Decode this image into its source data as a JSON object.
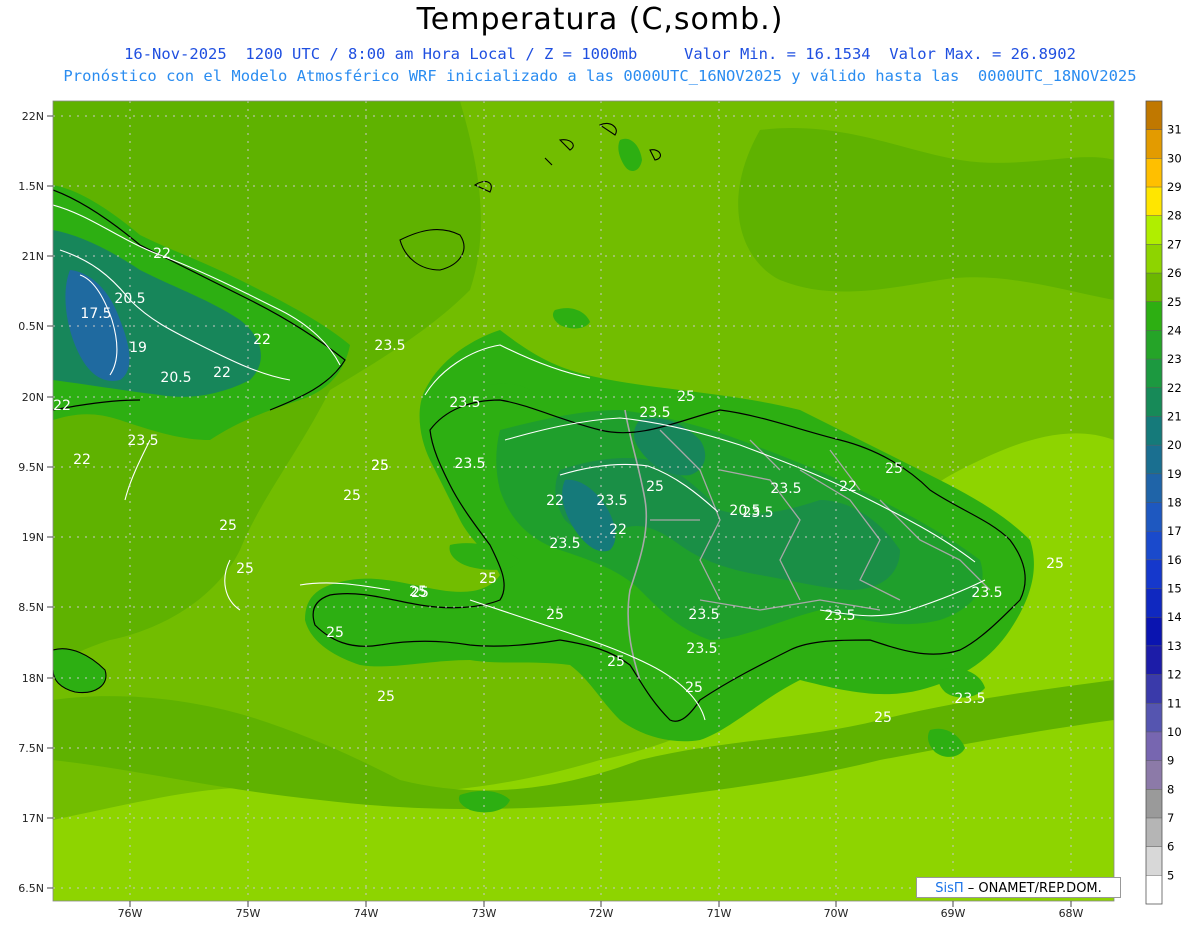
{
  "header": {
    "title": "Temperatura (C,somb.)",
    "line1_left": "16-Nov-2025  1200 UTC / 8:00 am Hora Local / Z = 1000mb",
    "line1_min": "Valor Min. = 16.1534",
    "line1_max": "Valor Max. = 26.8902",
    "line2": "Pronóstico con el Modelo Atmosférico WRF inicializado a las 0000UTC_16NOV2025 y válido hasta las  0000UTC_18NOV2025"
  },
  "map": {
    "lat_labels": [
      "22N",
      "1.5N",
      "21N",
      "0.5N",
      "20N",
      "9.5N",
      "19N",
      "8.5N",
      "18N",
      "7.5N",
      "17N",
      "6.5N"
    ],
    "lon_labels": [
      "76W",
      "75W",
      "74W",
      "73W",
      "72W",
      "71W",
      "70W",
      "69W",
      "68W"
    ],
    "contour_labels": [
      "22",
      "20.5",
      "17.5",
      "19",
      "20.5",
      "22",
      "22",
      "22",
      "23.5",
      "22",
      "23.5",
      "25",
      "25",
      "25",
      "25",
      "23.5",
      "25",
      "25",
      "23.5",
      "25",
      "22",
      "23.5",
      "25",
      "22",
      "23.5",
      "20.5",
      "23.5",
      "23.5",
      "22",
      "23.5",
      "23.5",
      "25",
      "25",
      "25",
      "25",
      "25",
      "23.5",
      "23.5",
      "23.5",
      "25",
      "25",
      "23.5",
      "25",
      "25",
      "25"
    ],
    "colors": {
      "ocean_dark": "#5fb200",
      "ocean_mid": "#72bd00",
      "ocean_light": "#8ed400",
      "land_24": "#2daf12",
      "land_23": "#1f9f2c",
      "land_22": "#1a8f46",
      "land_21": "#17865a",
      "land_20": "#157a7a",
      "land_19": "#1f6aa0"
    }
  },
  "colorbar": {
    "levels": [
      "31",
      "30",
      "29",
      "28",
      "27",
      "26",
      "25",
      "24",
      "23",
      "22",
      "21",
      "20",
      "19",
      "18",
      "17",
      "16",
      "15",
      "14",
      "13",
      "12",
      "11",
      "10",
      "9",
      "8",
      "7",
      "6",
      "5"
    ],
    "colors": [
      "#c07800",
      "#e39b00",
      "#ffbf00",
      "#ffe600",
      "#b0ee00",
      "#8ed400",
      "#6cb800",
      "#2daf12",
      "#25a428",
      "#1c9940",
      "#178a58",
      "#157a7a",
      "#1a6f90",
      "#1f64a8",
      "#1e58c0",
      "#1a4acc",
      "#1538cc",
      "#0f28c0",
      "#0a14b0",
      "#1c1ca8",
      "#3a3aaa",
      "#5555b0",
      "#7766b0",
      "#8c7aa8",
      "#9a9a9a",
      "#b5b5b5",
      "#d8d8d8",
      "#ffffff"
    ]
  },
  "credit": {
    "brand": "SisΠ",
    "text": " – ONAMET/REP.DOM."
  }
}
